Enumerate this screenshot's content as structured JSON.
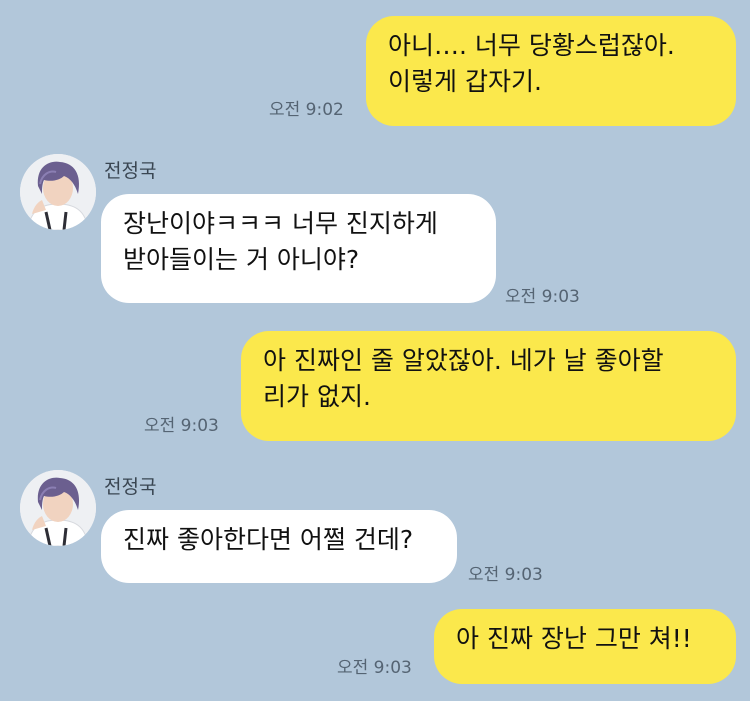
{
  "messages": [
    {
      "id": 1,
      "direction": "sent",
      "text": "아니…. 너무 당황스럽잖아.\n이렇게 갑자기.",
      "time": "오전 9:02"
    },
    {
      "id": 2,
      "direction": "received",
      "sender": "전정국",
      "text": "장난이야ㅋㅋㅋ 너무 진지하게\n받아들이는 거 아니야?",
      "time": "오전 9:03"
    },
    {
      "id": 3,
      "direction": "sent",
      "text": "아 진짜인 줄 알았잖아. 네가 날 좋아할\n리가 없지.",
      "time": "오전 9:03"
    },
    {
      "id": 4,
      "direction": "received",
      "sender": "전정국",
      "text": "진짜 좋아한다면 어쩔 건데?",
      "time": "오전 9:03"
    },
    {
      "id": 5,
      "direction": "sent",
      "text": "아 진짜 장난 그만 쳐!!",
      "time": "오전 9:03"
    }
  ],
  "colors": {
    "background": "#b2c7da",
    "sent_bubble": "#fbe84c",
    "received_bubble": "#ffffff",
    "timestamp": "#556473"
  },
  "icons": {
    "avatar": "profile-photo"
  }
}
